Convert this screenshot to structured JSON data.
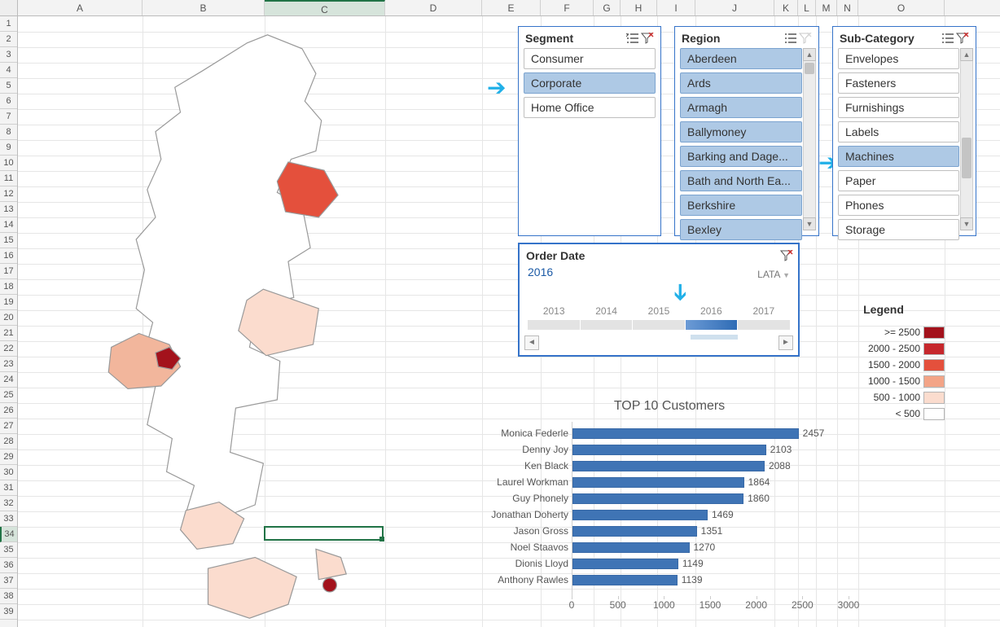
{
  "columns": [
    {
      "label": "A",
      "w": 153
    },
    {
      "label": "B",
      "w": 150
    },
    {
      "label": "C",
      "w": 148
    },
    {
      "label": "D",
      "w": 119
    },
    {
      "label": "E",
      "w": 72
    },
    {
      "label": "F",
      "w": 65
    },
    {
      "label": "G",
      "w": 33
    },
    {
      "label": "H",
      "w": 45
    },
    {
      "label": "I",
      "w": 47
    },
    {
      "label": "J",
      "w": 97
    },
    {
      "label": "K",
      "w": 29
    },
    {
      "label": "L",
      "w": 22
    },
    {
      "label": "M",
      "w": 26
    },
    {
      "label": "N",
      "w": 26
    },
    {
      "label": "O",
      "w": 106
    }
  ],
  "rowCount": 39,
  "activeCol": 2,
  "activeRow": 33,
  "segment": {
    "title": "Segment",
    "items": [
      {
        "label": "Consumer",
        "sel": false
      },
      {
        "label": "Corporate",
        "sel": true
      },
      {
        "label": "Home Office",
        "sel": false
      }
    ]
  },
  "region": {
    "title": "Region",
    "items": [
      {
        "label": "Aberdeen",
        "sel": true
      },
      {
        "label": "Ards",
        "sel": true
      },
      {
        "label": "Armagh",
        "sel": true
      },
      {
        "label": "Ballymoney",
        "sel": true
      },
      {
        "label": "Barking and Dage...",
        "sel": true
      },
      {
        "label": "Bath and North Ea...",
        "sel": true
      },
      {
        "label": "Berkshire",
        "sel": true
      },
      {
        "label": "Bexley",
        "sel": true
      }
    ]
  },
  "subcat": {
    "title": "Sub-Category",
    "items": [
      {
        "label": "Envelopes",
        "sel": false
      },
      {
        "label": "Fasteners",
        "sel": false
      },
      {
        "label": "Furnishings",
        "sel": false
      },
      {
        "label": "Labels",
        "sel": false
      },
      {
        "label": "Machines",
        "sel": true
      },
      {
        "label": "Paper",
        "sel": false
      },
      {
        "label": "Phones",
        "sel": false
      },
      {
        "label": "Storage",
        "sel": false
      }
    ]
  },
  "timeline": {
    "title": "Order Date",
    "value": "2016",
    "period": "LATA",
    "years": [
      "2013",
      "2014",
      "2015",
      "2016",
      "2017"
    ],
    "selectedIndex": 3
  },
  "legend": {
    "title": "Legend",
    "rows": [
      {
        "label": ">=    2500",
        "color": "#a3121c"
      },
      {
        "label": "2000 - 2500",
        "color": "#c6272c"
      },
      {
        "label": "1500 - 2000",
        "color": "#e4503c"
      },
      {
        "label": "1000 - 1500",
        "color": "#f3a487"
      },
      {
        "label": "500 - 1000",
        "color": "#fbdcce"
      },
      {
        "label": "<     500",
        "color": "#ffffff"
      }
    ]
  },
  "chart_data": {
    "type": "bar",
    "title": "TOP 10 Customers",
    "xlabel": "",
    "ylabel": "",
    "xlim": [
      0,
      3000
    ],
    "xticks": [
      0,
      500,
      1000,
      1500,
      2000,
      2500,
      3000
    ],
    "categories": [
      "Monica Federle",
      "Denny Joy",
      "Ken Black",
      "Laurel Workman",
      "Guy Phonely",
      "Jonathan Doherty",
      "Jason Gross",
      "Noel Staavos",
      "Dionis Lloyd",
      "Anthony Rawles"
    ],
    "values": [
      2457,
      2103,
      2088,
      1864,
      1860,
      1469,
      1351,
      1270,
      1149,
      1139
    ]
  }
}
